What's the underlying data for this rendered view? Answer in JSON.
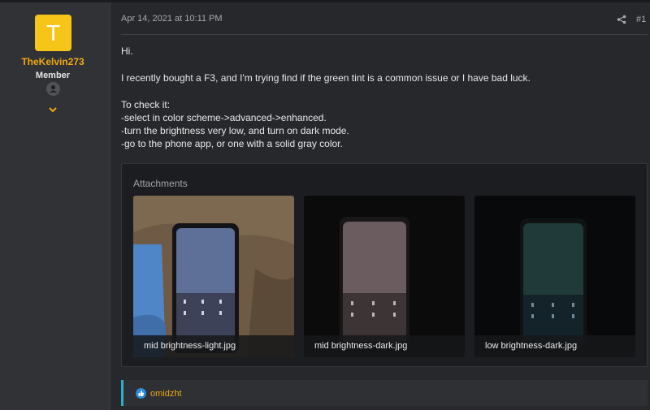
{
  "user": {
    "avatar_letter": "T",
    "name": "TheKelvin273",
    "title": "Member"
  },
  "post": {
    "date": "Apr 14, 2021 at 10:11 PM",
    "number": "#1",
    "lines": [
      "Hi.",
      "I recently bought a F3, and I'm trying find if the green tint is a common issue or I have bad luck.",
      "To check it:",
      "-select in color scheme->advanced->enhanced.",
      "-turn the brightness very low, and turn on dark mode.",
      "-go to the phone app, or one with a solid gray color."
    ]
  },
  "attachments": {
    "title": "Attachments",
    "items": [
      {
        "caption": "mid brightness-light.jpg"
      },
      {
        "caption": "mid brightness-dark.jpg"
      },
      {
        "caption": "low brightness-dark.jpg"
      }
    ]
  },
  "reactions": {
    "names": "omidzht"
  },
  "colors": {
    "accent_orange": "#f0a814",
    "avatar_bg": "#f5c518",
    "reaction_bar": "#2ab0cf",
    "like_icon": "#2e8bd6"
  }
}
